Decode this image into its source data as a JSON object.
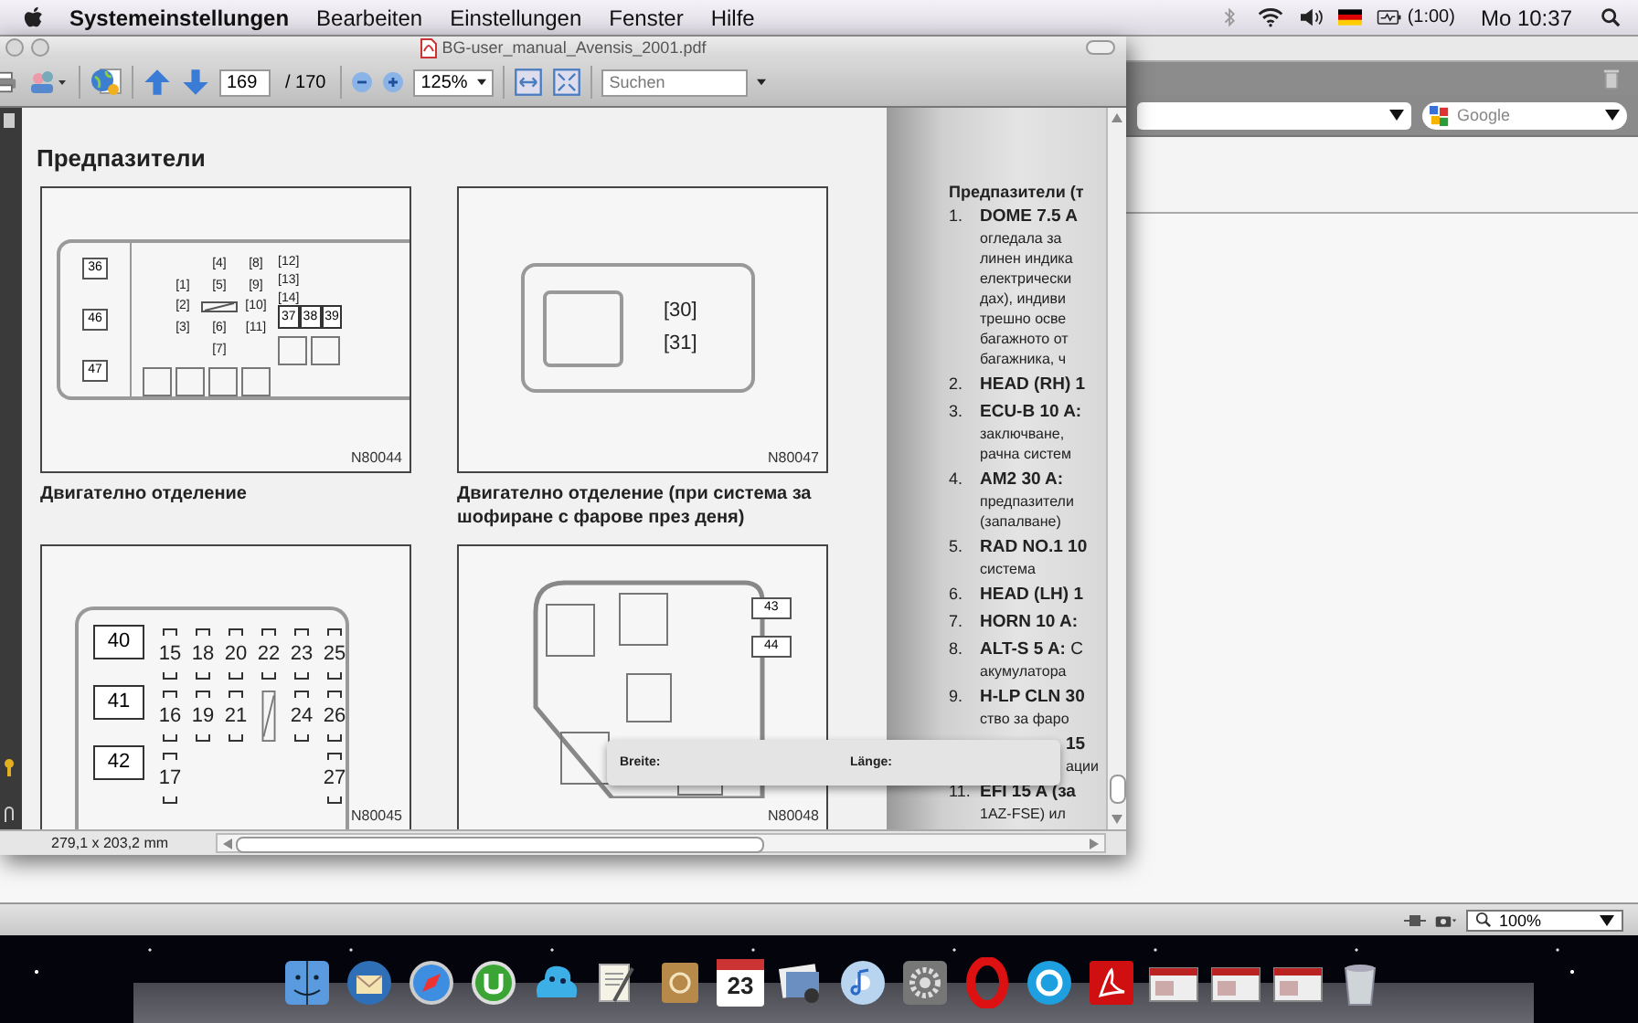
{
  "menubar": {
    "app_name": "Systemeinstellungen",
    "menus": [
      "Bearbeiten",
      "Einstellungen",
      "Fenster",
      "Hilfe"
    ],
    "battery_time": "(1:00)",
    "clock": "Mo 10:37"
  },
  "pdf_window": {
    "title": "BG-user_manual_Avensis_2001.pdf",
    "toolbar": {
      "page": "169",
      "page_total": "/ 170",
      "zoom": "125%",
      "search": {
        "placeholder": "Suchen"
      }
    },
    "page": {
      "heading": "Предпазители",
      "figures": [
        {
          "kind": "engine-main",
          "code": "N80044",
          "caption": "Двигателно отделение",
          "left_fuses": [
            "36",
            "46",
            "47"
          ],
          "rows": [
            [
              {
                "kind": "empty"
              },
              {
                "kind": "bracket",
                "label": "[4]"
              },
              {
                "kind": "bracket",
                "label": "[8]"
              }
            ],
            [
              {
                "kind": "bracket",
                "label": "[1]"
              },
              {
                "kind": "bracket",
                "label": "[5]"
              },
              {
                "kind": "bracket",
                "label": "[9]"
              }
            ],
            [
              {
                "kind": "bracket",
                "label": "[2]"
              },
              {
                "kind": "slash"
              },
              {
                "kind": "bracket",
                "label": "[10]"
              }
            ],
            [
              {
                "kind": "bracket",
                "label": "[3]"
              },
              {
                "kind": "bracket",
                "label": "[6]"
              },
              {
                "kind": "bracket",
                "label": "[11]"
              }
            ],
            [
              {
                "kind": "empty"
              },
              {
                "kind": "bracket",
                "label": "[7]"
              },
              {
                "kind": "empty"
              }
            ]
          ],
          "right_fuses": [
            "[12]",
            "[13]",
            "[14]"
          ],
          "relays": [
            "37",
            "38",
            "39"
          ]
        },
        {
          "kind": "daylight",
          "code": "N80047",
          "caption": "Двигателно отделение (при система за шофиране с фарове през деня)",
          "fuses": [
            "[30]",
            "[31]"
          ]
        },
        {
          "kind": "fuse-block",
          "code": "N80045",
          "left_fuses": [
            "40",
            "41",
            "42"
          ],
          "rows": [
            [
              {
                "kind": "fuse",
                "label": "15"
              },
              {
                "kind": "fuse",
                "label": "18"
              },
              {
                "kind": "fuse",
                "label": "20"
              },
              {
                "kind": "fuse",
                "label": "22"
              },
              {
                "kind": "fuse",
                "label": "23"
              },
              {
                "kind": "fuse",
                "label": "25"
              }
            ],
            [
              {
                "kind": "fuse",
                "label": "16"
              },
              {
                "kind": "fuse",
                "label": "19"
              },
              {
                "kind": "fuse",
                "label": "21"
              },
              {
                "kind": "slash"
              },
              {
                "kind": "fuse",
                "label": "24"
              },
              {
                "kind": "fuse",
                "label": "26"
              }
            ],
            [
              {
                "kind": "fuse",
                "label": "17"
              },
              {
                "kind": "empty"
              },
              {
                "kind": "empty"
              },
              {
                "kind": "empty"
              },
              {
                "kind": "empty"
              },
              {
                "kind": "fuse",
                "label": "27"
              }
            ]
          ]
        },
        {
          "kind": "relay-box",
          "code": "N80048",
          "fuses": [
            "43",
            "44"
          ]
        }
      ],
      "right_column": {
        "heading": "Предпазители (т",
        "items": [
          {
            "number": "1.",
            "title": "DOME 7.5 A",
            "lines": [
              "огледала за",
              "линен индика",
              "електрически",
              "дах), индиви",
              "трешно осве",
              "багажното от",
              "багажника, ч"
            ]
          },
          {
            "number": "2.",
            "title": "HEAD (RH) 1"
          },
          {
            "number": "3.",
            "title": "ECU-B 10 A:",
            "lines": [
              "заключване,",
              "рачна систем"
            ]
          },
          {
            "number": "4.",
            "title": "AM2 30 A:",
            "lines": [
              "предпазители",
              "(запалване)"
            ]
          },
          {
            "number": "5.",
            "title": "RAD NO.1 10",
            "lines": [
              "система"
            ]
          },
          {
            "number": "6.",
            "title": "HEAD (LH) 1"
          },
          {
            "number": "7.",
            "title": "HORN 10 A:"
          },
          {
            "number": "8.",
            "title": "**ALT-S 5 A:** С",
            "lines": [
              "акумулатора"
            ]
          },
          {
            "number": "9.",
            "title": "H-LP CLN 30",
            "lines": [
              "ство за фаро"
            ]
          },
          {
            "title": "15",
            "lines": [
              "ации"
            ]
          },
          {
            "number": "11.",
            "title": "EFI 15 A (за",
            "lines": [
              "1AZ-FSE) ил"
            ]
          }
        ]
      }
    },
    "status": "279,1 x 203,2 mm"
  },
  "measure_panel": {
    "width_label": "Breite:",
    "length_label": "Länge:"
  },
  "browser": {
    "search": {
      "placeholder": "Google"
    },
    "zoom": "100%"
  },
  "dock": {
    "calendar_day": "23"
  }
}
